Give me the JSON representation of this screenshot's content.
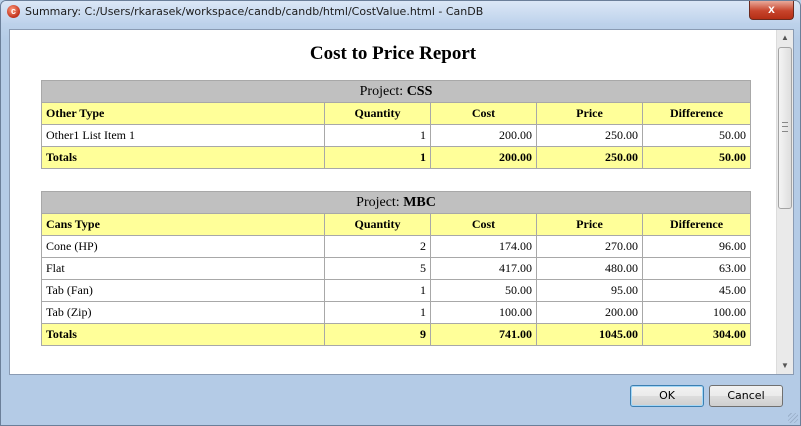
{
  "window": {
    "title": "Summary: C:/Users/rkarasek/workspace/candb/candb/html/CostValue.html - CanDB",
    "close_glyph": "x"
  },
  "report": {
    "title": "Cost to Price Report",
    "project_label": "Project:",
    "projects": [
      {
        "name": "CSS",
        "columns": [
          "Other Type",
          "Quantity",
          "Cost",
          "Price",
          "Difference"
        ],
        "rows": [
          [
            "Other1 List Item 1",
            "1",
            "200.00",
            "250.00",
            "50.00"
          ]
        ],
        "totals": [
          "Totals",
          "1",
          "200.00",
          "250.00",
          "50.00"
        ]
      },
      {
        "name": "MBC",
        "columns": [
          "Cans Type",
          "Quantity",
          "Cost",
          "Price",
          "Difference"
        ],
        "rows": [
          [
            "Cone (HP)",
            "2",
            "174.00",
            "270.00",
            "96.00"
          ],
          [
            "Flat",
            "5",
            "417.00",
            "480.00",
            "63.00"
          ],
          [
            "Tab (Fan)",
            "1",
            "50.00",
            "95.00",
            "45.00"
          ],
          [
            "Tab (Zip)",
            "1",
            "100.00",
            "200.00",
            "100.00"
          ]
        ],
        "totals": [
          "Totals",
          "9",
          "741.00",
          "1045.00",
          "304.00"
        ]
      }
    ]
  },
  "buttons": {
    "ok": "OK",
    "cancel": "Cancel"
  },
  "scrollbar": {
    "up_glyph": "▲",
    "down_glyph": "▼"
  }
}
